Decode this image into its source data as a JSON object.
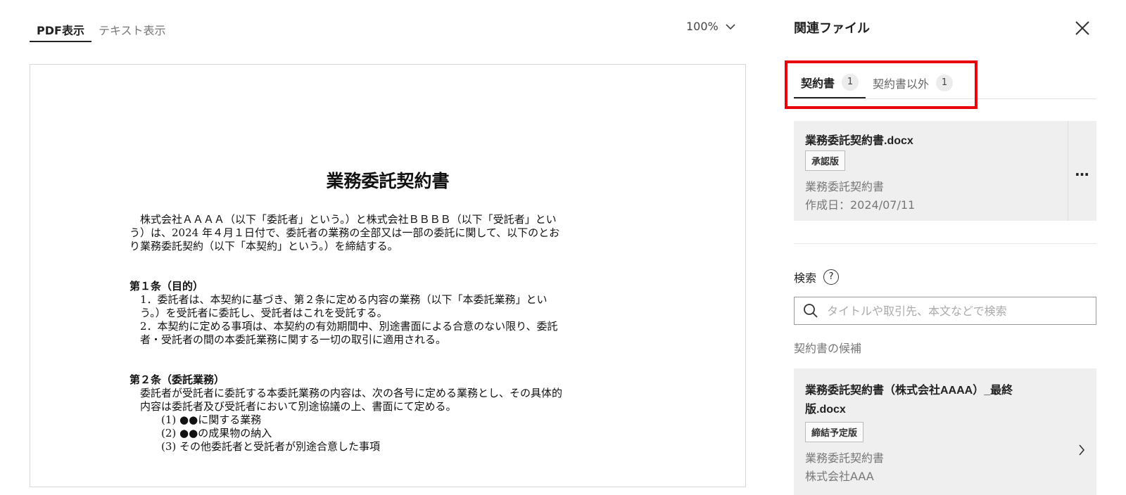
{
  "viewer": {
    "tabs": [
      {
        "label": "PDF表示",
        "active": true
      },
      {
        "label": "テキスト表示",
        "active": false
      }
    ],
    "zoom": "100%"
  },
  "document": {
    "title": "業務委託契約書",
    "intro_lines": [
      "株式会社ＡＡＡＡ（以下「委託者」という。）と株式会社ＢＢＢＢ（以下「受託者」とい",
      "う）は、2024 年４月１日付で、委託者の業務の全部又は一部の委託に関して、以下のとお",
      "り業務委託契約（以下「本契約」という。）を締結する。"
    ],
    "article1": {
      "title": "第１条（目的）",
      "lines": [
        "1．委託者は、本契約に基づき、第２条に定める内容の業務（以下「本委託業務」とい",
        "う。）を受託者に委託し、受託者はこれを受託する。",
        "2．本契約に定める事項は、本契約の有効期間中、別途書面による合意のない限り、委託",
        "者・受託者の間の本委託業務に関する一切の取引に適用される。"
      ]
    },
    "article2": {
      "title": "第２条（委託業務）",
      "lines": [
        "委託者が受託者に委託する本委託業務の内容は、次の各号に定める業務とし、その具体的",
        "内容は委託者及び受託者において別途協議の上、書面にて定める。"
      ],
      "items": [
        "(1) ●●に関する業務",
        "(2) ●●の成果物の納入",
        "(3) その他委託者と受託者が別途合意した事項"
      ]
    }
  },
  "panel": {
    "title": "関連ファイル",
    "tabs": [
      {
        "label": "契約書",
        "count": "1",
        "active": true
      },
      {
        "label": "契約書以外",
        "count": "1",
        "active": false
      }
    ],
    "file_card": {
      "name": "業務委託契約書.docx",
      "tag": "承認版",
      "type": "業務委託契約書",
      "created": "作成日：2024/07/11",
      "menu": "…"
    },
    "search": {
      "label": "検索",
      "help": "?",
      "placeholder": "タイトルや取引先、本文などで検索"
    },
    "candidates_label": "契約書の候補",
    "candidate": {
      "name": "業務委託契約書（株式会社AAAA）_最終版.docx",
      "tag": "締結予定版",
      "type": "業務委託契約書",
      "partner": "株式会社AAA"
    }
  },
  "colors": {
    "highlight": "#e8000b",
    "card_bg": "#efefef"
  }
}
